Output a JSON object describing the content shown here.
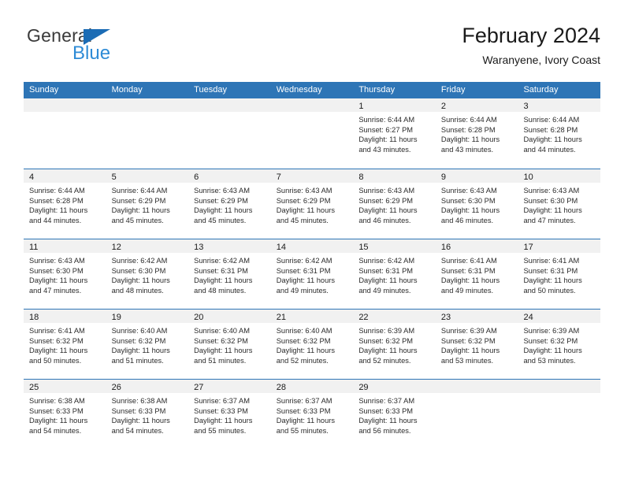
{
  "brand": {
    "name_part1": "General",
    "name_part2": "Blue",
    "triangle_icon": "triangle-icon"
  },
  "header": {
    "title": "February 2024",
    "subtitle": "Waranyene, Ivory Coast"
  },
  "calendar": {
    "weekday_headers": [
      "Sunday",
      "Monday",
      "Tuesday",
      "Wednesday",
      "Thursday",
      "Friday",
      "Saturday"
    ],
    "colors": {
      "header_blue": "#2e75b6",
      "day_band_gray": "#f1f1f1",
      "text": "#1a1a1a",
      "logo_blue": "#2e8bd6"
    },
    "weeks": [
      [
        {
          "day": "",
          "empty": true
        },
        {
          "day": "",
          "empty": true
        },
        {
          "day": "",
          "empty": true
        },
        {
          "day": "",
          "empty": true
        },
        {
          "day": "1",
          "sunrise": "Sunrise: 6:44 AM",
          "sunset": "Sunset: 6:27 PM",
          "daylight": "Daylight: 11 hours and 43 minutes."
        },
        {
          "day": "2",
          "sunrise": "Sunrise: 6:44 AM",
          "sunset": "Sunset: 6:28 PM",
          "daylight": "Daylight: 11 hours and 43 minutes."
        },
        {
          "day": "3",
          "sunrise": "Sunrise: 6:44 AM",
          "sunset": "Sunset: 6:28 PM",
          "daylight": "Daylight: 11 hours and 44 minutes."
        }
      ],
      [
        {
          "day": "4",
          "sunrise": "Sunrise: 6:44 AM",
          "sunset": "Sunset: 6:28 PM",
          "daylight": "Daylight: 11 hours and 44 minutes."
        },
        {
          "day": "5",
          "sunrise": "Sunrise: 6:44 AM",
          "sunset": "Sunset: 6:29 PM",
          "daylight": "Daylight: 11 hours and 45 minutes."
        },
        {
          "day": "6",
          "sunrise": "Sunrise: 6:43 AM",
          "sunset": "Sunset: 6:29 PM",
          "daylight": "Daylight: 11 hours and 45 minutes."
        },
        {
          "day": "7",
          "sunrise": "Sunrise: 6:43 AM",
          "sunset": "Sunset: 6:29 PM",
          "daylight": "Daylight: 11 hours and 45 minutes."
        },
        {
          "day": "8",
          "sunrise": "Sunrise: 6:43 AM",
          "sunset": "Sunset: 6:29 PM",
          "daylight": "Daylight: 11 hours and 46 minutes."
        },
        {
          "day": "9",
          "sunrise": "Sunrise: 6:43 AM",
          "sunset": "Sunset: 6:30 PM",
          "daylight": "Daylight: 11 hours and 46 minutes."
        },
        {
          "day": "10",
          "sunrise": "Sunrise: 6:43 AM",
          "sunset": "Sunset: 6:30 PM",
          "daylight": "Daylight: 11 hours and 47 minutes."
        }
      ],
      [
        {
          "day": "11",
          "sunrise": "Sunrise: 6:43 AM",
          "sunset": "Sunset: 6:30 PM",
          "daylight": "Daylight: 11 hours and 47 minutes."
        },
        {
          "day": "12",
          "sunrise": "Sunrise: 6:42 AM",
          "sunset": "Sunset: 6:30 PM",
          "daylight": "Daylight: 11 hours and 48 minutes."
        },
        {
          "day": "13",
          "sunrise": "Sunrise: 6:42 AM",
          "sunset": "Sunset: 6:31 PM",
          "daylight": "Daylight: 11 hours and 48 minutes."
        },
        {
          "day": "14",
          "sunrise": "Sunrise: 6:42 AM",
          "sunset": "Sunset: 6:31 PM",
          "daylight": "Daylight: 11 hours and 49 minutes."
        },
        {
          "day": "15",
          "sunrise": "Sunrise: 6:42 AM",
          "sunset": "Sunset: 6:31 PM",
          "daylight": "Daylight: 11 hours and 49 minutes."
        },
        {
          "day": "16",
          "sunrise": "Sunrise: 6:41 AM",
          "sunset": "Sunset: 6:31 PM",
          "daylight": "Daylight: 11 hours and 49 minutes."
        },
        {
          "day": "17",
          "sunrise": "Sunrise: 6:41 AM",
          "sunset": "Sunset: 6:31 PM",
          "daylight": "Daylight: 11 hours and 50 minutes."
        }
      ],
      [
        {
          "day": "18",
          "sunrise": "Sunrise: 6:41 AM",
          "sunset": "Sunset: 6:32 PM",
          "daylight": "Daylight: 11 hours and 50 minutes."
        },
        {
          "day": "19",
          "sunrise": "Sunrise: 6:40 AM",
          "sunset": "Sunset: 6:32 PM",
          "daylight": "Daylight: 11 hours and 51 minutes."
        },
        {
          "day": "20",
          "sunrise": "Sunrise: 6:40 AM",
          "sunset": "Sunset: 6:32 PM",
          "daylight": "Daylight: 11 hours and 51 minutes."
        },
        {
          "day": "21",
          "sunrise": "Sunrise: 6:40 AM",
          "sunset": "Sunset: 6:32 PM",
          "daylight": "Daylight: 11 hours and 52 minutes."
        },
        {
          "day": "22",
          "sunrise": "Sunrise: 6:39 AM",
          "sunset": "Sunset: 6:32 PM",
          "daylight": "Daylight: 11 hours and 52 minutes."
        },
        {
          "day": "23",
          "sunrise": "Sunrise: 6:39 AM",
          "sunset": "Sunset: 6:32 PM",
          "daylight": "Daylight: 11 hours and 53 minutes."
        },
        {
          "day": "24",
          "sunrise": "Sunrise: 6:39 AM",
          "sunset": "Sunset: 6:32 PM",
          "daylight": "Daylight: 11 hours and 53 minutes."
        }
      ],
      [
        {
          "day": "25",
          "sunrise": "Sunrise: 6:38 AM",
          "sunset": "Sunset: 6:33 PM",
          "daylight": "Daylight: 11 hours and 54 minutes."
        },
        {
          "day": "26",
          "sunrise": "Sunrise: 6:38 AM",
          "sunset": "Sunset: 6:33 PM",
          "daylight": "Daylight: 11 hours and 54 minutes."
        },
        {
          "day": "27",
          "sunrise": "Sunrise: 6:37 AM",
          "sunset": "Sunset: 6:33 PM",
          "daylight": "Daylight: 11 hours and 55 minutes."
        },
        {
          "day": "28",
          "sunrise": "Sunrise: 6:37 AM",
          "sunset": "Sunset: 6:33 PM",
          "daylight": "Daylight: 11 hours and 55 minutes."
        },
        {
          "day": "29",
          "sunrise": "Sunrise: 6:37 AM",
          "sunset": "Sunset: 6:33 PM",
          "daylight": "Daylight: 11 hours and 56 minutes."
        },
        {
          "day": "",
          "empty": true
        },
        {
          "day": "",
          "empty": true
        }
      ]
    ]
  }
}
